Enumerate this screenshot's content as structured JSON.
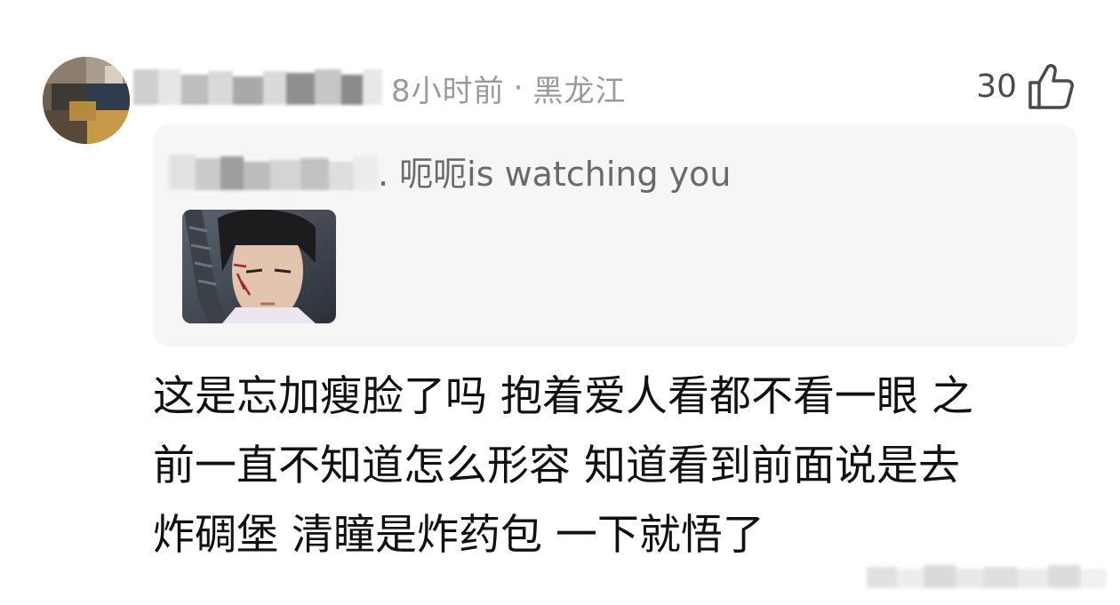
{
  "comment_header": {
    "avatar_icon": "user-avatar",
    "username_obscured": true,
    "time_ago": "8小时前",
    "separator": "·",
    "location": "黑龙江"
  },
  "likes": {
    "count": "30",
    "icon": "thumbs-up-icon"
  },
  "quoted_reply": {
    "author_obscured": true,
    "text": ". 呃呃is watching you",
    "has_image": true
  },
  "comment": {
    "text": "这是忘加瘦脸了吗 抱着爱人看都不看一眼 之\n前一直不知道怎么形容 知道看到前面说是去\n炸碉堡 清瞳是炸药包 一下就悟了"
  },
  "watermark": {
    "obscured": true
  },
  "colors": {
    "quote_bg": "#f6f6f6",
    "meta_text": "#9a9a9a",
    "body_text": "#111111"
  }
}
